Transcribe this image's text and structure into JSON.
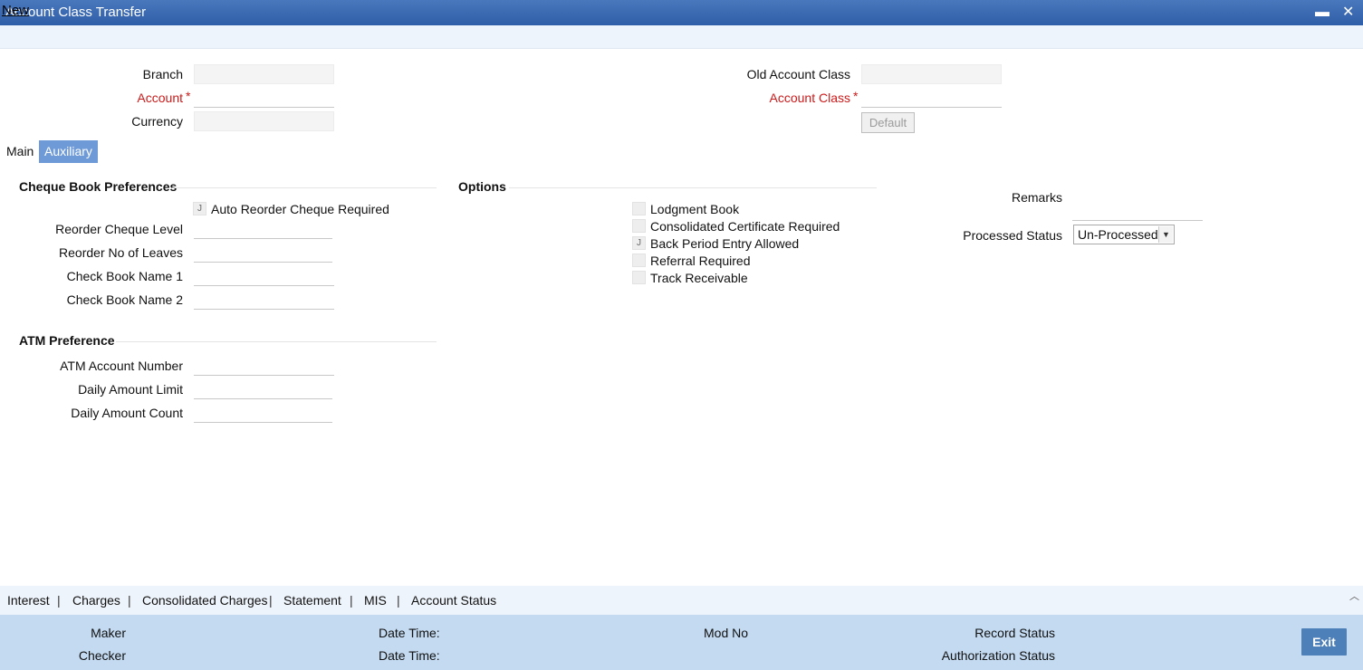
{
  "window": {
    "title": "Account Class Transfer",
    "minimize_glyph": "▬",
    "close_glyph": "✕"
  },
  "menu": {
    "new_label": "New"
  },
  "header": {
    "branch_label": "Branch",
    "account_label": "Account",
    "currency_label": "Currency",
    "old_account_class_label": "Old Account Class",
    "account_class_label": "Account Class",
    "required_mark": "*",
    "default_button": "Default"
  },
  "tabs": [
    {
      "label": "Main",
      "active": false
    },
    {
      "label": "Auxiliary",
      "active": true
    }
  ],
  "cheque_book": {
    "title": "Cheque Book Preferences",
    "auto_reorder_label": "Auto Reorder Cheque Required",
    "reorder_level_label": "Reorder Cheque Level",
    "reorder_leaves_label": "Reorder No of Leaves",
    "check_book_name1_label": "Check Book Name 1",
    "check_book_name2_label": "Check Book Name 2"
  },
  "atm": {
    "title": "ATM Preference",
    "account_number_label": "ATM Account Number",
    "daily_limit_label": "Daily Amount Limit",
    "daily_count_label": "Daily Amount Count"
  },
  "options": {
    "title": "Options",
    "items": [
      {
        "label": "Lodgment Book",
        "checked": false
      },
      {
        "label": "Consolidated Certificate Required",
        "checked": false
      },
      {
        "label": "Back Period Entry Allowed",
        "checked": true
      },
      {
        "label": "Referral Required",
        "checked": false
      },
      {
        "label": "Track Receivable",
        "checked": false
      }
    ],
    "check_glyph": "J"
  },
  "remarks": {
    "remarks_label": "Remarks",
    "processed_status_label": "Processed Status",
    "processed_status_value": "Un-Processed"
  },
  "nav": {
    "items": [
      "Interest",
      "Charges",
      "Consolidated Charges",
      "Statement",
      "MIS",
      "Account Status"
    ],
    "separator": "|"
  },
  "footer": {
    "maker_label": "Maker",
    "checker_label": "Checker",
    "date_time_label": "Date Time:",
    "mod_no_label": "Mod No",
    "record_status_label": "Record Status",
    "authorization_status_label": "Authorization Status",
    "exit_button": "Exit"
  },
  "colors": {
    "titlebar": "#2f5ea8",
    "required": "#cc1a1a",
    "active_tab": "#6f9ad8",
    "footer": "#c3daf1",
    "exit_button": "#4d7fb8"
  }
}
